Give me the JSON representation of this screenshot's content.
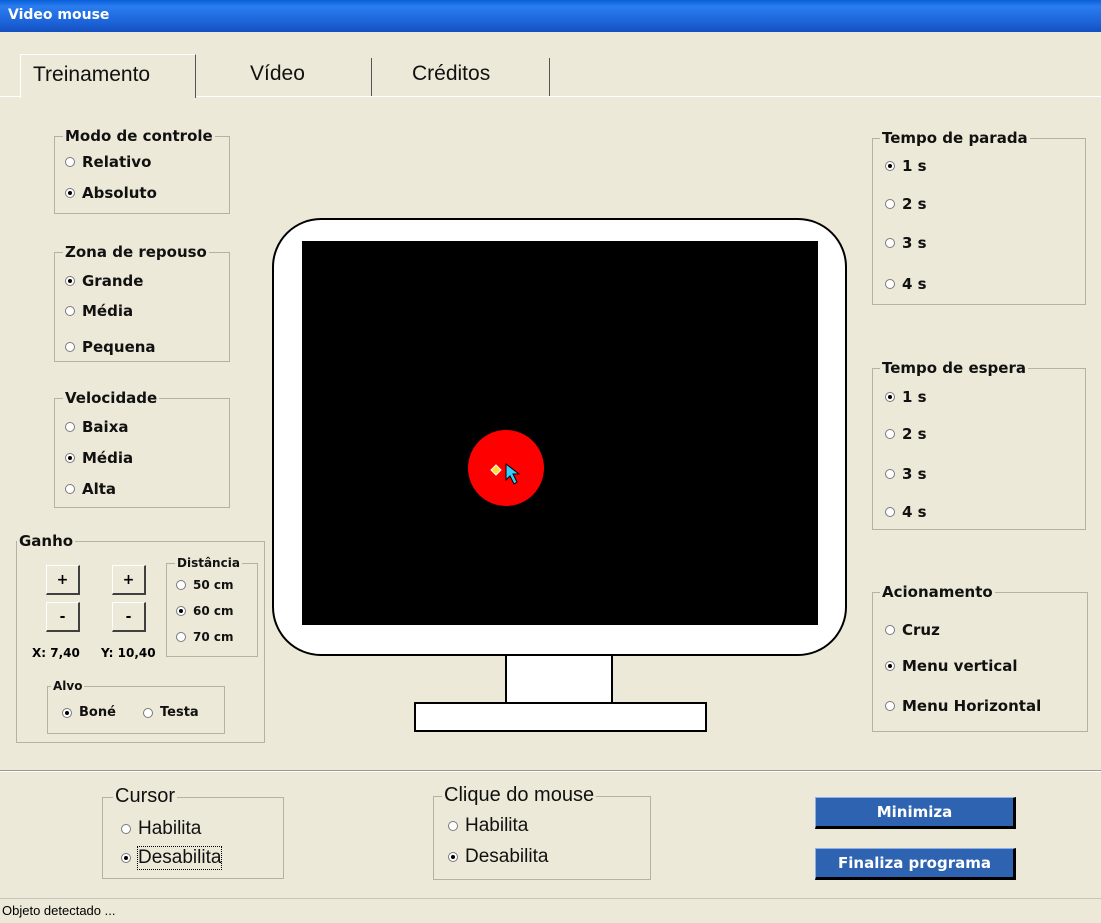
{
  "window": {
    "title": "Video mouse"
  },
  "tabs": [
    {
      "label": "Treinamento",
      "active": true
    },
    {
      "label": "Vídeo",
      "active": false
    },
    {
      "label": "Créditos",
      "active": false
    }
  ],
  "modo_controle": {
    "title": "Modo de controle",
    "options": [
      {
        "label": "Relativo",
        "selected": false
      },
      {
        "label": "Absoluto",
        "selected": true
      }
    ]
  },
  "zona_repouso": {
    "title": "Zona de repouso",
    "options": [
      {
        "label": "Grande",
        "selected": true
      },
      {
        "label": "Média",
        "selected": false
      },
      {
        "label": "Pequena",
        "selected": false
      }
    ]
  },
  "velocidade": {
    "title": "Velocidade",
    "options": [
      {
        "label": "Baixa",
        "selected": false
      },
      {
        "label": "Média",
        "selected": true
      },
      {
        "label": "Alta",
        "selected": false
      }
    ]
  },
  "ganho": {
    "title": "Ganho",
    "plus_label": "+",
    "minus_label": "-",
    "x_readout": "X: 7,40",
    "y_readout": "Y: 10,40",
    "distancia": {
      "title": "Distância",
      "options": [
        {
          "label": "50 cm",
          "selected": false
        },
        {
          "label": "60 cm",
          "selected": true
        },
        {
          "label": "70 cm",
          "selected": false
        }
      ]
    },
    "alvo": {
      "title": "Alvo",
      "options": [
        {
          "label": "Boné",
          "selected": true
        },
        {
          "label": "Testa",
          "selected": false
        }
      ]
    }
  },
  "tempo_parada": {
    "title": "Tempo de parada",
    "options": [
      {
        "label": "1 s",
        "selected": true
      },
      {
        "label": "2 s",
        "selected": false
      },
      {
        "label": "3 s",
        "selected": false
      },
      {
        "label": "4 s",
        "selected": false
      }
    ]
  },
  "tempo_espera": {
    "title": "Tempo de espera",
    "options": [
      {
        "label": "1 s",
        "selected": true
      },
      {
        "label": "2 s",
        "selected": false
      },
      {
        "label": "3 s",
        "selected": false
      },
      {
        "label": "4 s",
        "selected": false
      }
    ]
  },
  "acionamento": {
    "title": "Acionamento",
    "options": [
      {
        "label": "Cruz",
        "selected": false
      },
      {
        "label": "Menu vertical",
        "selected": true
      },
      {
        "label": "Menu Horizontal",
        "selected": false
      }
    ]
  },
  "cursor": {
    "title": "Cursor",
    "options": [
      {
        "label": "Habilita",
        "selected": false
      },
      {
        "label": "Desabilita",
        "selected": true
      }
    ]
  },
  "clique": {
    "title": "Clique do mouse",
    "options": [
      {
        "label": "Habilita",
        "selected": false
      },
      {
        "label": "Desabilita",
        "selected": true
      }
    ]
  },
  "buttons": {
    "minimiza": "Minimiza",
    "finaliza": "Finaliza programa"
  },
  "status": {
    "text": "Objeto detectado ..."
  },
  "colors": {
    "target": "#ff0000",
    "screen": "#000000",
    "titlebar": "#1c63d8",
    "button": "#2e63b2",
    "cursor": "#33ccff"
  }
}
